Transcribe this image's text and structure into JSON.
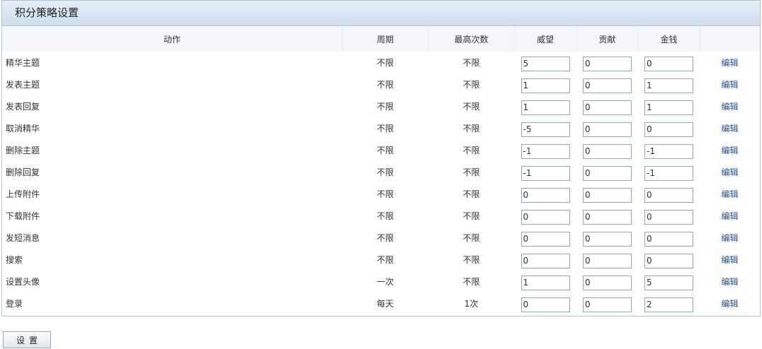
{
  "panel": {
    "title": "积分策略设置"
  },
  "table": {
    "headers": [
      "动作",
      "周期",
      "最高次数",
      "威望",
      "贡献",
      "金钱",
      ""
    ],
    "rows": [
      {
        "action": "精华主题",
        "period": "不限",
        "max": "不限",
        "prestige": "5",
        "contribution": "0",
        "money": "0",
        "edit": "编辑"
      },
      {
        "action": "发表主题",
        "period": "不限",
        "max": "不限",
        "prestige": "1",
        "contribution": "0",
        "money": "1",
        "edit": "编辑"
      },
      {
        "action": "发表回复",
        "period": "不限",
        "max": "不限",
        "prestige": "1",
        "contribution": "0",
        "money": "1",
        "edit": "编辑"
      },
      {
        "action": "取消精华",
        "period": "不限",
        "max": "不限",
        "prestige": "-5",
        "contribution": "0",
        "money": "0",
        "edit": "编辑"
      },
      {
        "action": "删除主题",
        "period": "不限",
        "max": "不限",
        "prestige": "-1",
        "contribution": "0",
        "money": "-1",
        "edit": "编辑"
      },
      {
        "action": "删除回复",
        "period": "不限",
        "max": "不限",
        "prestige": "-1",
        "contribution": "0",
        "money": "-1",
        "edit": "编辑"
      },
      {
        "action": "上传附件",
        "period": "不限",
        "max": "不限",
        "prestige": "0",
        "contribution": "0",
        "money": "0",
        "edit": "编辑"
      },
      {
        "action": "下载附件",
        "period": "不限",
        "max": "不限",
        "prestige": "0",
        "contribution": "0",
        "money": "0",
        "edit": "编辑"
      },
      {
        "action": "发短消息",
        "period": "不限",
        "max": "不限",
        "prestige": "0",
        "contribution": "0",
        "money": "0",
        "edit": "编辑"
      },
      {
        "action": "搜索",
        "period": "不限",
        "max": "不限",
        "prestige": "0",
        "contribution": "0",
        "money": "0",
        "edit": "编辑"
      },
      {
        "action": "设置头像",
        "period": "一次",
        "max": "不限",
        "prestige": "1",
        "contribution": "0",
        "money": "5",
        "edit": "编辑"
      },
      {
        "action": "登录",
        "period": "每天",
        "max": "1次",
        "prestige": "0",
        "contribution": "0",
        "money": "2",
        "edit": "编辑"
      }
    ]
  },
  "footer": {
    "submit_label": "设置"
  }
}
